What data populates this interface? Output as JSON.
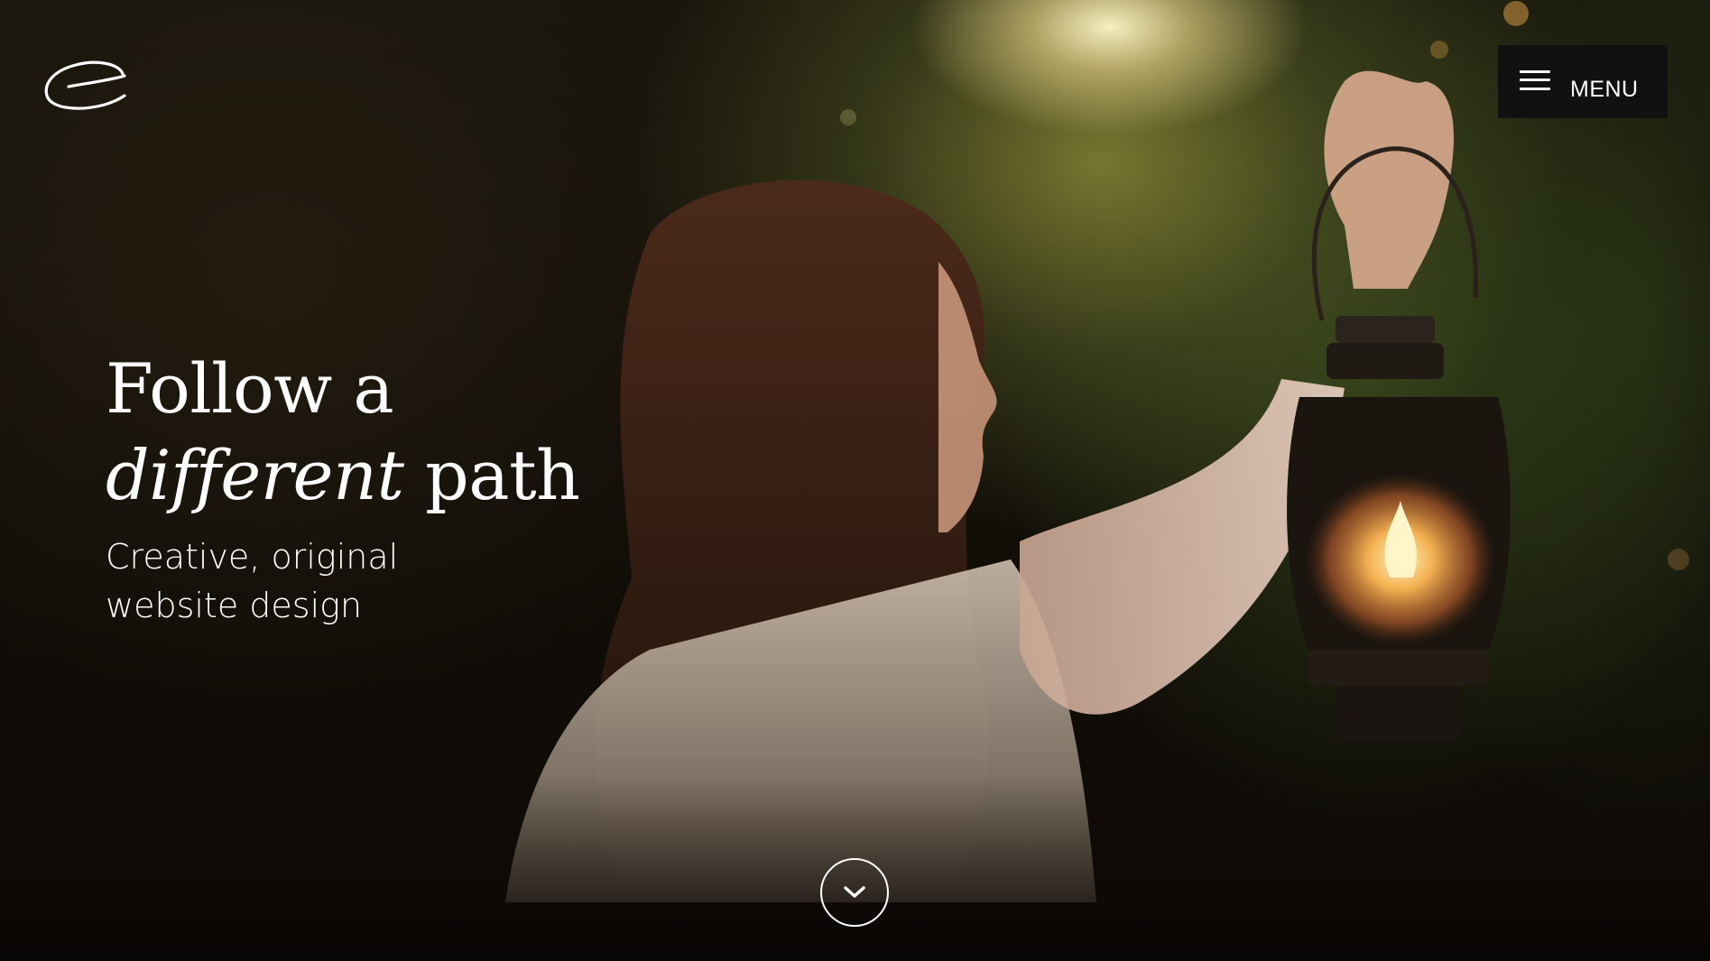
{
  "header": {
    "logo_icon": "swirl-e-logo",
    "menu": {
      "icon": "hamburger-icon",
      "label": "MENU"
    }
  },
  "hero": {
    "headline_line1": "Follow a",
    "headline_italic": "different",
    "headline_rest": " path",
    "subhead_line1": "Creative, original",
    "subhead_line2": "website design",
    "scroll_icon": "chevron-down-icon"
  },
  "colors": {
    "text": "#ffffff",
    "menu_background": "#111111",
    "page_background": "#0c0905"
  }
}
